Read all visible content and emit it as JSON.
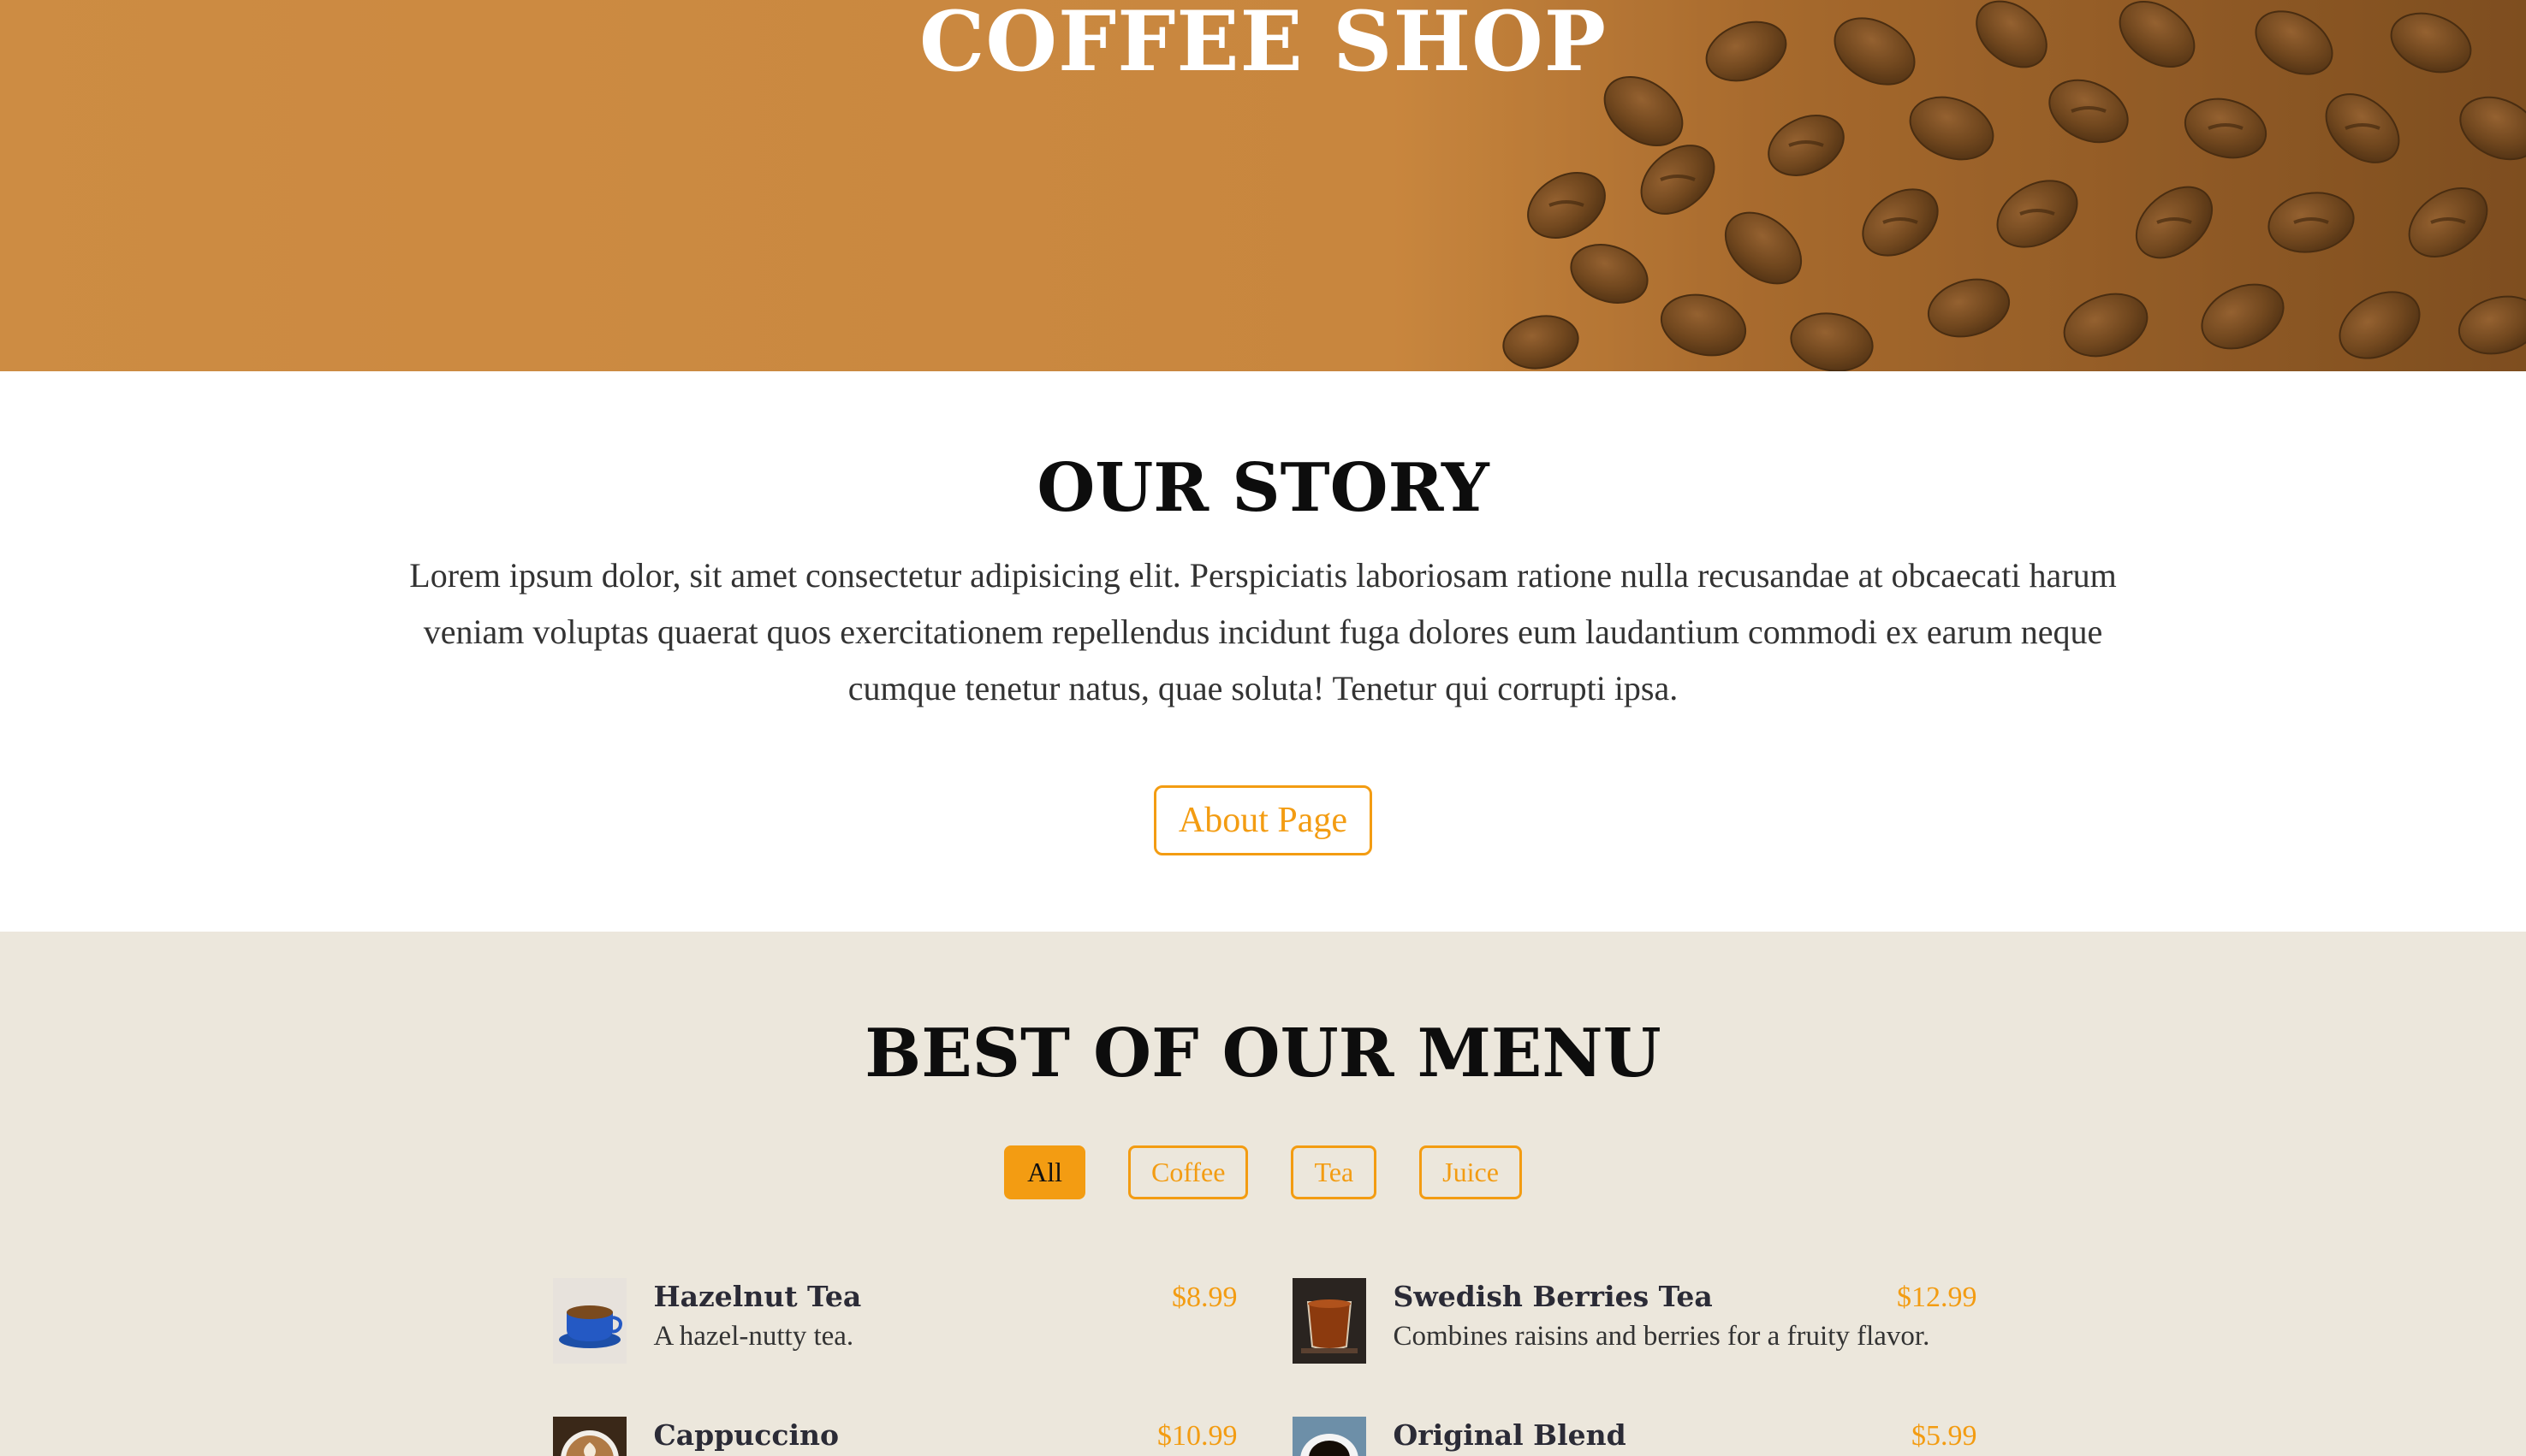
{
  "hero": {
    "title": "COFFEE SHOP"
  },
  "story": {
    "title": "OUR STORY",
    "text": "Lorem ipsum dolor, sit amet consectetur adipisicing elit. Perspiciatis laboriosam ratione nulla recusandae at obcaecati harum veniam voluptas quaerat quos exercitationem repellendus incidunt fuga dolores eum laudantium commodi ex earum neque cumque tenetur natus, quae soluta! Tenetur qui corrupti ipsa.",
    "button_label": "About Page"
  },
  "menu": {
    "title": "BEST OF OUR MENU",
    "filters": [
      {
        "label": "All",
        "active": true
      },
      {
        "label": "Coffee",
        "active": false
      },
      {
        "label": "Tea",
        "active": false
      },
      {
        "label": "Juice",
        "active": false
      }
    ],
    "items": [
      {
        "name": "Hazelnut Tea",
        "price": "$8.99",
        "description": "A hazel-nutty tea.",
        "thumb": "blue-cup-tea-icon"
      },
      {
        "name": "Swedish Berries Tea",
        "price": "$12.99",
        "description": "Combines raisins and berries for a fruity flavor.",
        "thumb": "glass-tea-icon"
      },
      {
        "name": "Cappuccino",
        "price": "$10.99",
        "description": "",
        "thumb": "latte-art-icon"
      },
      {
        "name": "Original Blend",
        "price": "$5.99",
        "description": "",
        "thumb": "black-coffee-icon"
      }
    ]
  },
  "colors": {
    "accent": "#f39c12",
    "menu_bg": "#ece7dc",
    "hero_tone": "#c9873f"
  }
}
